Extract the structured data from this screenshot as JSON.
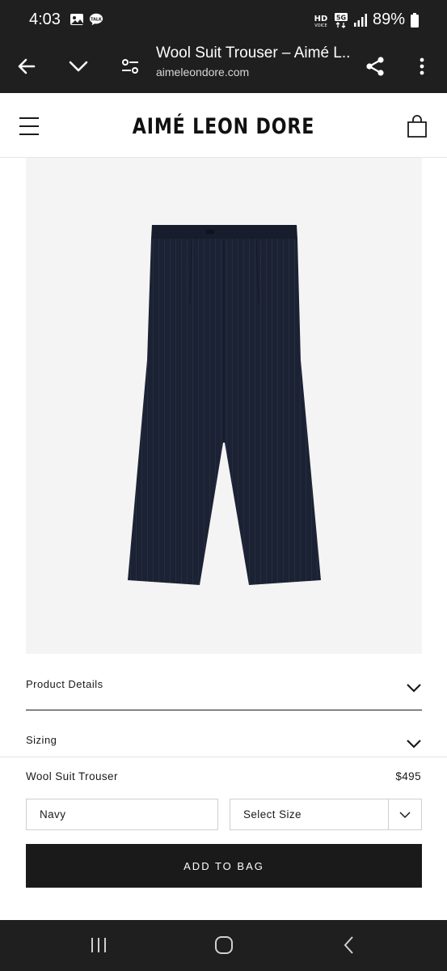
{
  "status_bar": {
    "time": "4:03",
    "battery_percent": "89%",
    "network_label": "5G",
    "hd_label": "HD"
  },
  "browser": {
    "page_title": "Wool Suit Trouser – Aimé L...",
    "url": "aimeleondore.com"
  },
  "site": {
    "logo_text": "AIMÉ LEON DORE"
  },
  "product": {
    "image_alt": "Navy wool suit trouser",
    "name": "Wool Suit Trouser",
    "price": "$495",
    "color_value": "Navy",
    "size_placeholder": "Select Size",
    "add_to_bag_label": "ADD TO BAG"
  },
  "accordions": [
    {
      "label": "Product Details"
    },
    {
      "label": "Sizing"
    }
  ],
  "colors": {
    "browser_chrome": "#1f1f1f",
    "image_background": "#f4f4f4",
    "trouser_navy": "#1b2233",
    "button_black": "#1a1a1a"
  }
}
